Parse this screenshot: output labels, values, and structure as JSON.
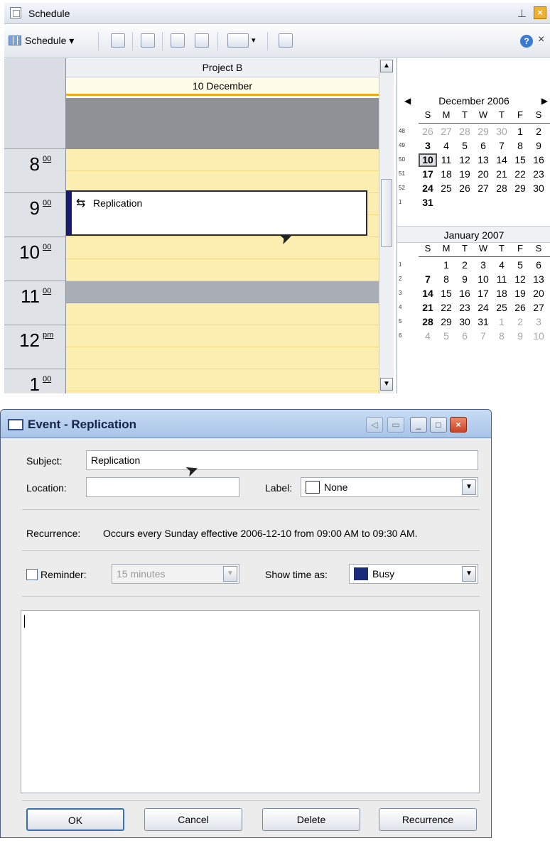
{
  "schedule_window": {
    "title": "Schedule",
    "toolbar": {
      "view_label": "Schedule"
    },
    "resource": "Project B",
    "date_header": "10 December",
    "hours": [
      {
        "h": "8",
        "suffix": "00"
      },
      {
        "h": "9",
        "suffix": "00"
      },
      {
        "h": "10",
        "suffix": "00"
      },
      {
        "h": "11",
        "suffix": "00"
      },
      {
        "h": "12",
        "suffix": "pm"
      },
      {
        "h": "1",
        "suffix": "00"
      }
    ],
    "event": {
      "title": "Replication"
    },
    "mini_calendar": {
      "months": [
        {
          "title": "December 2006",
          "dow": [
            "S",
            "M",
            "T",
            "W",
            "T",
            "F",
            "S"
          ],
          "weeks": [
            {
              "wk": "48",
              "days": [
                "26",
                "27",
                "28",
                "29",
                "30",
                "1",
                "2"
              ]
            },
            {
              "wk": "49",
              "days": [
                "3",
                "4",
                "5",
                "6",
                "7",
                "8",
                "9"
              ]
            },
            {
              "wk": "50",
              "days": [
                "10",
                "11",
                "12",
                "13",
                "14",
                "15",
                "16"
              ]
            },
            {
              "wk": "51",
              "days": [
                "17",
                "18",
                "19",
                "20",
                "21",
                "22",
                "23"
              ]
            },
            {
              "wk": "52",
              "days": [
                "24",
                "25",
                "26",
                "27",
                "28",
                "29",
                "30"
              ]
            },
            {
              "wk": "1",
              "days": [
                "31",
                "",
                "",
                "",
                "",
                "",
                ""
              ]
            }
          ]
        },
        {
          "title": "January 2007",
          "dow": [
            "S",
            "M",
            "T",
            "W",
            "T",
            "F",
            "S"
          ],
          "weeks": [
            {
              "wk": "1",
              "days": [
                "",
                "1",
                "2",
                "3",
                "4",
                "5",
                "6"
              ]
            },
            {
              "wk": "2",
              "days": [
                "7",
                "8",
                "9",
                "10",
                "11",
                "12",
                "13"
              ]
            },
            {
              "wk": "3",
              "days": [
                "14",
                "15",
                "16",
                "17",
                "18",
                "19",
                "20"
              ]
            },
            {
              "wk": "4",
              "days": [
                "21",
                "22",
                "23",
                "24",
                "25",
                "26",
                "27"
              ]
            },
            {
              "wk": "5",
              "days": [
                "28",
                "29",
                "30",
                "31",
                "1",
                "2",
                "3"
              ]
            },
            {
              "wk": "6",
              "days": [
                "4",
                "5",
                "6",
                "7",
                "8",
                "9",
                "10"
              ]
            }
          ]
        }
      ]
    }
  },
  "event_dialog": {
    "title": "Event - Replication",
    "subject_label": "Subject:",
    "subject_value": "Replication",
    "location_label": "Location:",
    "location_value": "",
    "label_label": "Label:",
    "label_value": "None",
    "recurrence_label": "Recurrence:",
    "recurrence_text": "Occurs every Sunday effective 2006-12-10 from 09:00 AM to 09:30 AM.",
    "reminder_label": "Reminder:",
    "reminder_value": "15 minutes",
    "reminder_checked": false,
    "show_time_label": "Show time as:",
    "show_time_value": "Busy",
    "busy_color": "#1c2a7a",
    "buttons": {
      "ok": "OK",
      "cancel": "Cancel",
      "delete": "Delete",
      "recurrence": "Recurrence"
    }
  }
}
